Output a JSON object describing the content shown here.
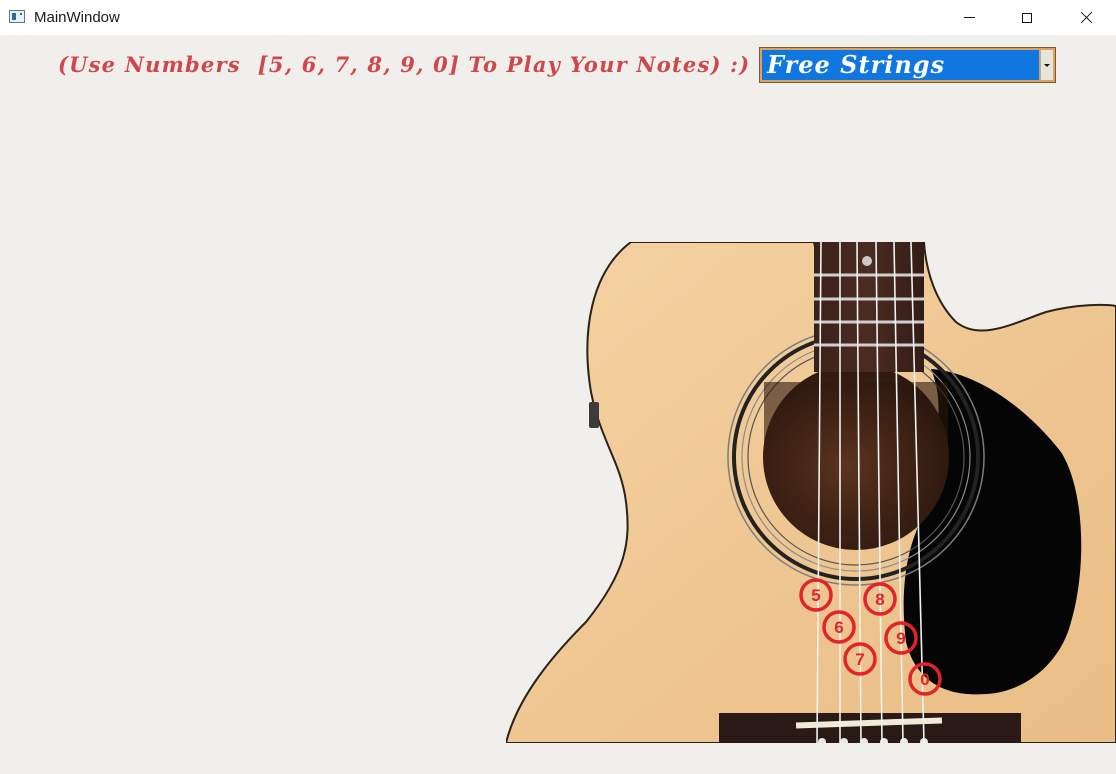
{
  "window": {
    "title": "MainWindow",
    "icon": "app-window-icon"
  },
  "instruction": {
    "text": "(Use Numbers  [5, 6, 7, 8, 9, 0] To Play Your Notes) :)",
    "color": "#d0474b"
  },
  "mode_select": {
    "selected": "Free Strings",
    "highlight_color": "#1177e0"
  },
  "guitar": {
    "note_markers": [
      "5",
      "6",
      "7",
      "8",
      "9",
      "0"
    ],
    "marker_color": "#e2232a"
  }
}
